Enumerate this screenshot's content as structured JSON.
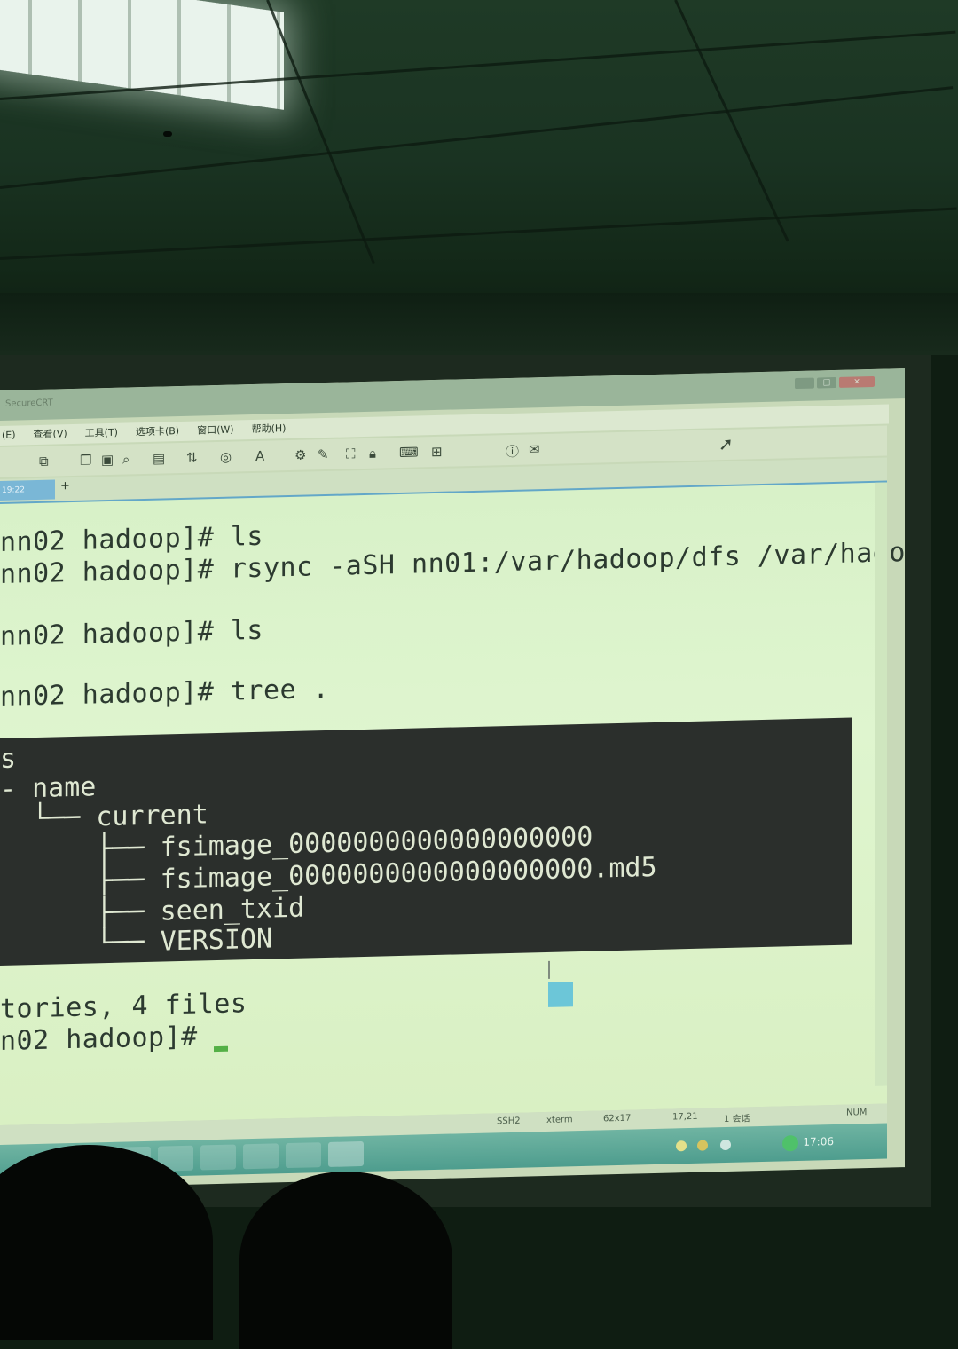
{
  "app": {
    "title": "SecureCRT",
    "menu": [
      "(E)",
      "查看(V)",
      "工具(T)",
      "选项卡(B)",
      "窗口(W)",
      "帮助(H)"
    ],
    "tab": {
      "label": "19:22",
      "add": "+"
    }
  },
  "terminal": {
    "lines": [
      "nn02 hadoop]# ls",
      "nn02 hadoop]# rsync -aSH nn01:/var/hadoop/dfs /var/hadoo",
      "",
      "nn02 hadoop]# ls",
      "",
      "nn02 hadoop]# tree ."
    ],
    "tree": [
      "s",
      "- name",
      "  └── current",
      "      ├── fsimage_0000000000000000000",
      "      ├── fsimage_0000000000000000000.md5",
      "      ├── seen_txid",
      "      └── VERSION"
    ],
    "summary": "tories, 4 files",
    "prompt": "n02 hadoop]# "
  },
  "status": {
    "protocol": "SSH2",
    "terminal_type": "xterm",
    "size": "62x17",
    "cursor_pos": "17,21",
    "sessions": "1 会话",
    "num": "NUM"
  },
  "taskbar": {
    "clock": "17:06"
  },
  "icons": [
    "window-minimize-icon",
    "window-maximize-icon",
    "window-close-icon",
    "cursor-arrow-icon",
    "help-icon",
    "chat-icon"
  ],
  "colors": {
    "terminal_bg": "#dff5cf",
    "tree_bg": "#2b2f2c",
    "tab_accent": "#63a7c8",
    "cursor": "#54b046"
  }
}
